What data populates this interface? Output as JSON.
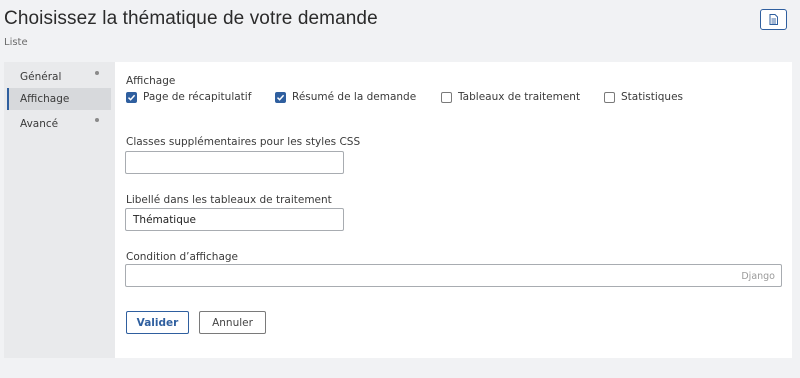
{
  "header": {
    "title": "Choisissez la thématique de votre demande",
    "subtitle": "Liste"
  },
  "sidebar": {
    "items": [
      {
        "label": "Général",
        "has_dot": true,
        "active": false
      },
      {
        "label": "Affichage",
        "has_dot": false,
        "active": true
      },
      {
        "label": "Avancé",
        "has_dot": true,
        "active": false
      }
    ]
  },
  "display": {
    "section_label": "Affichage",
    "options": [
      {
        "label": "Page de récapitulatif",
        "checked": true
      },
      {
        "label": "Résumé de la demande",
        "checked": true
      },
      {
        "label": "Tableaux de traitement",
        "checked": false
      },
      {
        "label": "Statistiques",
        "checked": false
      }
    ]
  },
  "fields": {
    "css_classes": {
      "label": "Classes supplémentaires pour les styles CSS",
      "value": ""
    },
    "table_label": {
      "label": "Libellé dans les tableaux de traitement",
      "value": "Thématique"
    },
    "condition": {
      "label": "Condition d’affichage",
      "value": "",
      "hint": "Django"
    }
  },
  "actions": {
    "submit_label": "Valider",
    "cancel_label": "Annuler"
  },
  "colors": {
    "accent": "#2f5f9f",
    "background": "#f1f2f4",
    "sidebar_background": "#e9eaec",
    "content_background": "#ffffff"
  },
  "icons": {
    "header_button": "document-icon"
  }
}
